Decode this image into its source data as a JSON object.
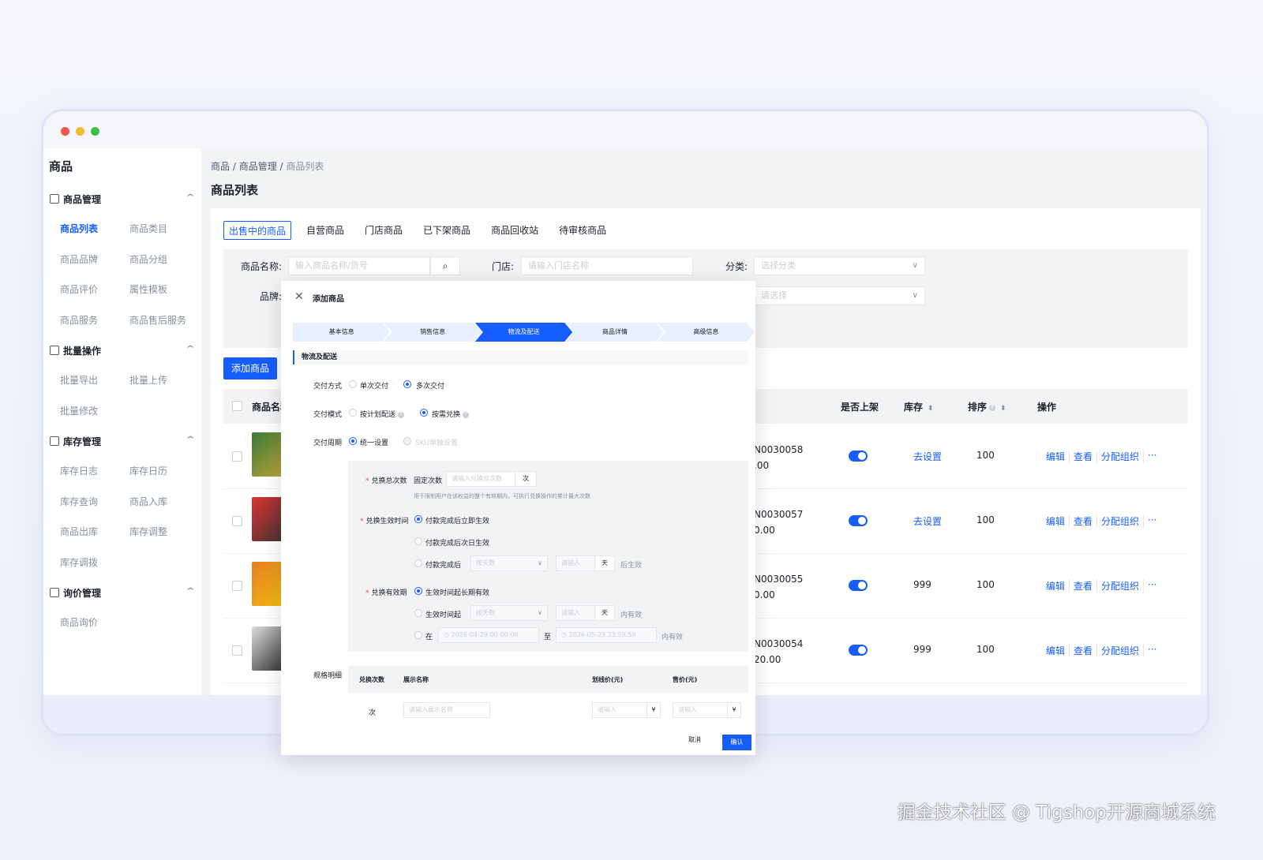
{
  "sidebar": {
    "title": "商品",
    "groups": [
      {
        "label": "商品管理",
        "items": [
          "商品列表",
          "商品类目",
          "商品品牌",
          "商品分组",
          "商品评价",
          "属性模板",
          "商品服务",
          "商品售后服务"
        ]
      },
      {
        "label": "批量操作",
        "items": [
          "批量导出",
          "批量上传",
          "批量修改"
        ]
      },
      {
        "label": "库存管理",
        "items": [
          "库存日志",
          "库存日历",
          "库存查询",
          "商品入库",
          "商品出库",
          "库存调整",
          "库存调拨"
        ]
      },
      {
        "label": "询价管理",
        "items": [
          "商品询价"
        ]
      }
    ]
  },
  "breadcrumb": [
    "商品",
    "商品管理",
    "商品列表"
  ],
  "page_title": "商品列表",
  "tabs": [
    "出售中的商品",
    "自营商品",
    "门店商品",
    "已下架商品",
    "商品回收站",
    "待审核商品"
  ],
  "filter": {
    "name_label": "商品名称:",
    "name_placeholder": "输入商品名称/货号",
    "store_label": "门店:",
    "store_placeholder": "请输入门店名称",
    "category_label": "分类:",
    "category_placeholder": "选择分类",
    "brand_label": "品牌:",
    "brand_placeholder": "请选择"
  },
  "add_button": "添加商品",
  "table": {
    "headers": [
      "商品名称",
      "是否上架",
      "库存",
      "排序",
      "操作"
    ],
    "rows": [
      {
        "code": "N0030058",
        "price": ".00",
        "stock": "去设置",
        "stock_link": true,
        "sort": "100"
      },
      {
        "code": "N0030057",
        "price": "0.00",
        "stock": "去设置",
        "stock_link": true,
        "sort": "100"
      },
      {
        "code": "N0030055",
        "price": "0.00",
        "stock": "999",
        "stock_link": false,
        "sort": "100"
      },
      {
        "code": "N0030054",
        "price": "20.00",
        "stock": "999",
        "stock_link": false,
        "sort": "100"
      }
    ],
    "ops": [
      "编辑",
      "查看",
      "分配组织",
      "···"
    ]
  },
  "modal": {
    "title": "添加商品",
    "steps": [
      "基本信息",
      "销售信息",
      "物流及配送",
      "商品详情",
      "高级信息"
    ],
    "section": "物流及配送",
    "delivery_method_label": "交付方式",
    "delivery_method_opts": [
      "单次交付",
      "多次交付"
    ],
    "delivery_mode_label": "交付模式",
    "delivery_mode_opts": [
      "按计划配送",
      "按需兑换"
    ],
    "delivery_cycle_label": "交付周期",
    "delivery_cycle_opts": [
      "统一设置",
      "SKU单独设置"
    ],
    "total_label": "兑换总次数",
    "fixed_label": "固定次数",
    "total_placeholder": "请输入兑换总次数",
    "unit_times": "次",
    "total_hint": "用于限制用户在该权益的整个有效期内，可执行兑换操作的累计最大次数",
    "effect_label": "兑换生效时间",
    "effect_opts": [
      "付款完成后立即生效",
      "付款完成后次日生效",
      "付款完成后"
    ],
    "by_days": "按天数",
    "input_ph": "请输入",
    "unit_day": "天",
    "after_effect": "后生效",
    "valid_label": "兑换有效期",
    "valid_opts": [
      "生效时间起长期有效",
      "生效时间起",
      "在"
    ],
    "within_valid": "内有效",
    "date_from": "2026-04-29 00:00:00",
    "to": "至",
    "date_to": "2026-05-29 23:59:59",
    "spec_label": "规格明细",
    "spec_headers": [
      "兑换次数",
      "展示名称",
      "划线价(元)",
      "售价(元)"
    ],
    "spec_row_times": "次",
    "spec_name_ph": "请输入展示名称",
    "currency": "¥",
    "cancel": "取消",
    "confirm": "确认"
  },
  "watermark": "掘金技术社区 @ Tigshop开源商城系统"
}
